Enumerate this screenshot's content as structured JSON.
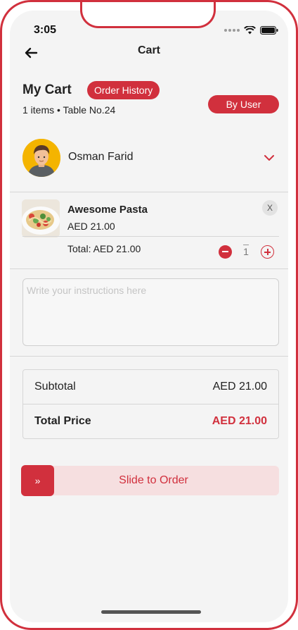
{
  "status_bar": {
    "time": "3:05"
  },
  "header": {
    "title": "Cart"
  },
  "cart": {
    "title": "My Cart",
    "order_history_label": "Order History",
    "meta": "1 items • Table No.24",
    "by_user_label": "By User"
  },
  "user": {
    "name": "Osman Farid"
  },
  "items": [
    {
      "name": "Awesome Pasta",
      "price": "AED 21.00",
      "total": "Total: AED 21.00",
      "quantity": "1",
      "remove_label": "X"
    }
  ],
  "instructions": {
    "placeholder": "Write your instructions here"
  },
  "summary": {
    "subtotal_label": "Subtotal",
    "subtotal_value": "AED 21.00",
    "total_label": "Total Price",
    "total_value": "AED 21.00"
  },
  "slide": {
    "handle_glyph": "»",
    "label": "Slide to Order"
  },
  "colors": {
    "accent": "#d1303d",
    "accent_light": "#f6dfe0",
    "background": "#f4f4f4"
  }
}
